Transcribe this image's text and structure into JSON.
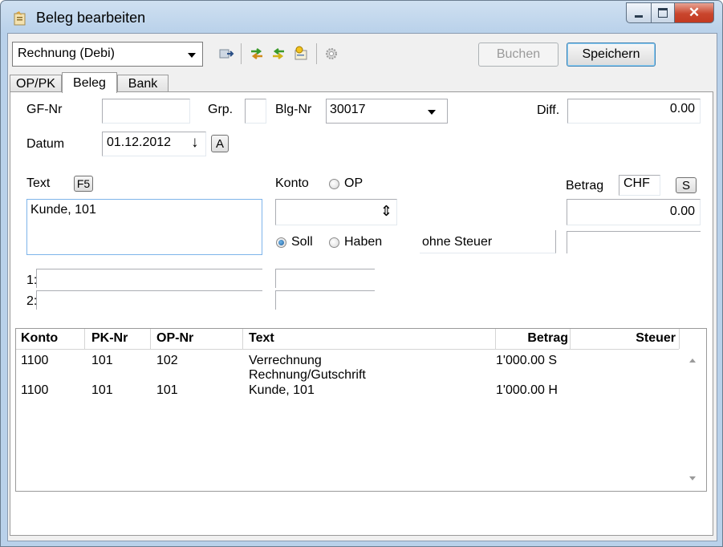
{
  "window": {
    "title": "Beleg bearbeiten"
  },
  "toolbar": {
    "type_select": "Rechnung (Debi)",
    "buchen_label": "Buchen",
    "speichern_label": "Speichern"
  },
  "tabs": [
    {
      "label": "OP/PK"
    },
    {
      "label": "Beleg"
    },
    {
      "label": "Bank"
    }
  ],
  "form": {
    "gf_nr_label": "GF-Nr",
    "gf_nr_value": "",
    "grp_label": "Grp.",
    "blg_nr_label": "Blg-Nr",
    "blg_nr_value": "30017",
    "diff_label": "Diff.",
    "diff_value": "0.00",
    "datum_label": "Datum",
    "datum_value": "01.12.2012",
    "datum_btn_symbol": "↓",
    "a_button": "A",
    "text_label": "Text",
    "f5_button": "F5",
    "text_value": "Kunde, 101",
    "konto_label": "Konto",
    "op_label": "OP",
    "konto_spinner_symbol": "⇕",
    "betrag_label": "Betrag",
    "currency": "CHF",
    "s_button": "S",
    "betrag_value": "0.00",
    "soll_label": "Soll",
    "haben_label": "Haben",
    "steuer_select": "ohne Steuer",
    "line1_label": "1:",
    "line2_label": "2:"
  },
  "grid": {
    "columns": [
      "Konto",
      "PK-Nr",
      "OP-Nr",
      "Text",
      "Betrag",
      "Steuer"
    ],
    "rows": [
      {
        "konto": "1100",
        "pk": "101",
        "op": "102",
        "text1": "Verrechnung",
        "text2": "Rechnung/Gutschrift",
        "betrag": "1'000.00 S",
        "steuer": ""
      },
      {
        "konto": "1100",
        "pk": "101",
        "op": "101",
        "text1": "Kunde, 101",
        "text2": "",
        "betrag": "1'000.00 H",
        "steuer": ""
      }
    ]
  }
}
